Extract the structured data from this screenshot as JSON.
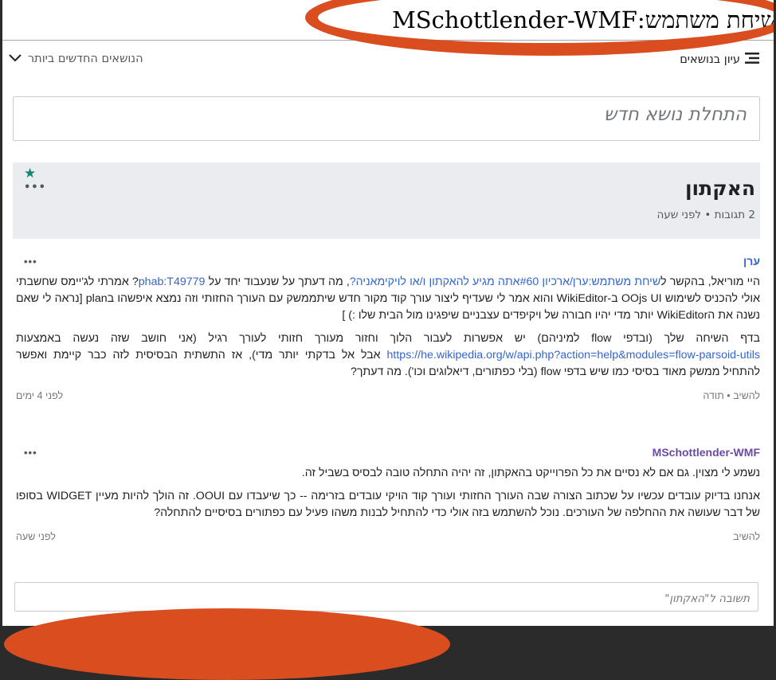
{
  "page_title": "שיחת משתמש:MSchottlender-WMF",
  "topic_bar": {
    "browse_label": "עיון בנושאים",
    "sort_label": "הנושאים החדשים ביותר"
  },
  "new_topic_placeholder": "התחלת נושא חדש",
  "topic": {
    "title": "האקתון",
    "meta": "2 תגובות • לפני שעה"
  },
  "posts": [
    {
      "author": "ערן",
      "p1_a": "היי מוריאל, בהקשר ל",
      "p1_link1": "שיחת משתמש:ערן/ארכיון #60אתה מגיע להאקתון ו/או לויקימאניה?",
      "p1_b": ", מה דעתך על שנעבוד יחד על ",
      "p1_link2": "phab:T49779",
      "p1_c": "? אמרתי לג'יימס שחשבתי אולי להכניס לשימוש OOjs UI ב-WikiEditor והוא אמר לי שעדיף ליצור עורך קוד מקור חדש שיתממשק עם העורך החזותי וזה נמצא איפשהו בplan [נראה לי שאם נשנה את הWikiEditor יותר מדי יהיו חבורה של ויקיפדים עצבניים שיפגינו מול הבית שלו :) ]",
      "p2_a": "בדף השיחה שלך (ובדפי flow למיניהם) יש אפשרות לעבור הלוך וחזור מעורך חזותי לעורך רגיל (אני חושב שזה נעשה באמצעות ",
      "p2_link": "https://he.wikipedia.org/w/api.php?action=help&modules=flow-parsoid-utils",
      "p2_b": " אבל אל בדקתי יותר מדי), אז התשתית הבסיסית לזה כבר קיימת ואפשר להתחיל ממשק מאוד בסיסי כמו שיש בדפי flow (בלי כפתורים, דיאלוגים וכו'). מה דעתך?",
      "actions": "להשיב  •  תודה",
      "time": "לפני 4 ימים"
    },
    {
      "author": "MSchottlender-WMF",
      "p1": "נשמע לי מצוין. גם אם לא נסיים את כל הפרוייקט בהאקתון, זה יהיה התחלה טובה לבסיס בשביל זה.",
      "p2": "אנחנו בדיוק עובדים עכשיו על שכתוב הצורה שבה העורך החזותי ועורך קוד הויקי עובדים בזרימה -- כך שיעבדו עם OOUI. זה הולך להיות מעיין WIDGET בסופו של דבר שעושה את ההחלפה של העורכים. נוכל להשתמש בזה אולי כדי להתחיל לבנות משהו פעיל עם כפתורים בסיסיים להתחלה?",
      "actions": "להשיב",
      "time": "לפני שעה"
    }
  ],
  "reply_placeholder": "תשובה ל\"האקתון\"",
  "colors": {
    "highlight": "#d94d1f",
    "link": "#3366cc",
    "header_bg": "#eaecf0",
    "star": "#14866d"
  }
}
